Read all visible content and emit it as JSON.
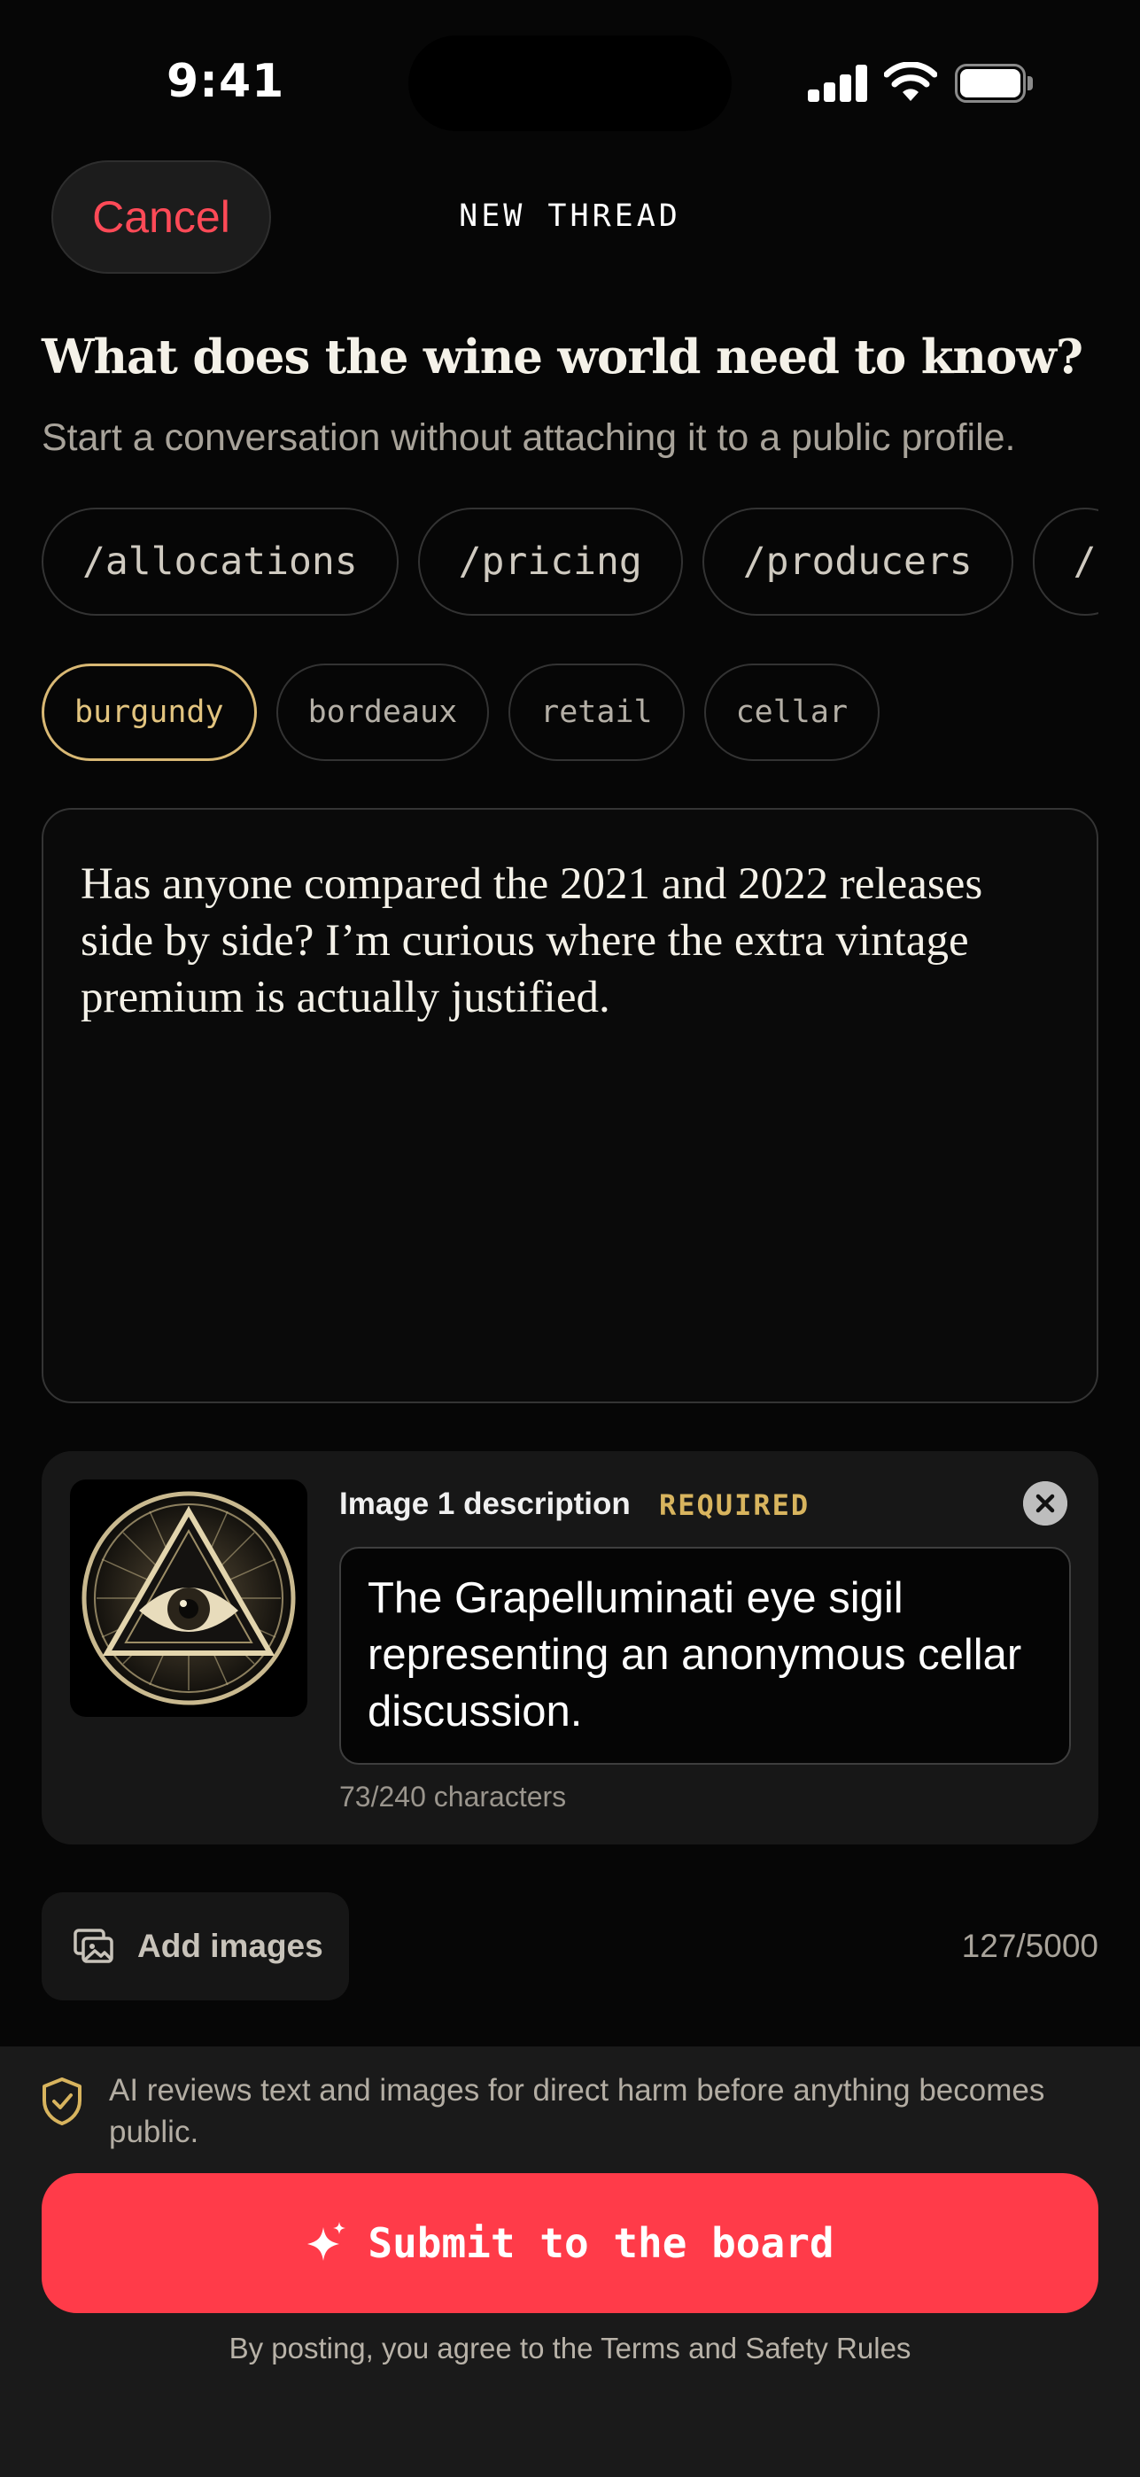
{
  "status_bar": {
    "time": "9:41"
  },
  "header": {
    "cancel_label": "Cancel",
    "title": "NEW THREAD"
  },
  "intro": {
    "headline": "What does the wine world need to know?",
    "subhead": "Start a conversation without attaching it to a public profile."
  },
  "channels": [
    "/allocations",
    "/pricing",
    "/producers",
    "/"
  ],
  "tags": [
    {
      "label": "burgundy",
      "selected": true
    },
    {
      "label": "bordeaux",
      "selected": false
    },
    {
      "label": "retail",
      "selected": false
    },
    {
      "label": "cellar",
      "selected": false
    }
  ],
  "composer": {
    "text": "Has anyone compared the 2021 and 2022 releases side by side? I’m curious where the extra vintage premium is actually justified."
  },
  "image_card": {
    "thumbnail_icon": "eye-sigil-icon",
    "label": "Image 1 description",
    "required": "REQUIRED",
    "description": "The Grapelluminati eye sigil representing an anonymous cellar discussion.",
    "char_count": "73/240 characters"
  },
  "actions": {
    "add_images_label": "Add images",
    "total_count": "127/5000"
  },
  "footer": {
    "notice": "AI reviews text and images for direct harm before anything becomes public.",
    "submit_label": "Submit to the board",
    "legal_prefix": "By posting, you agree to the",
    "terms": "Terms",
    "and": "and",
    "safety": "Safety Rules"
  },
  "colors": {
    "accent_red": "#ff3b49",
    "cancel_red": "#ff4a57",
    "gold": "#d8b874",
    "background": "#060606"
  }
}
